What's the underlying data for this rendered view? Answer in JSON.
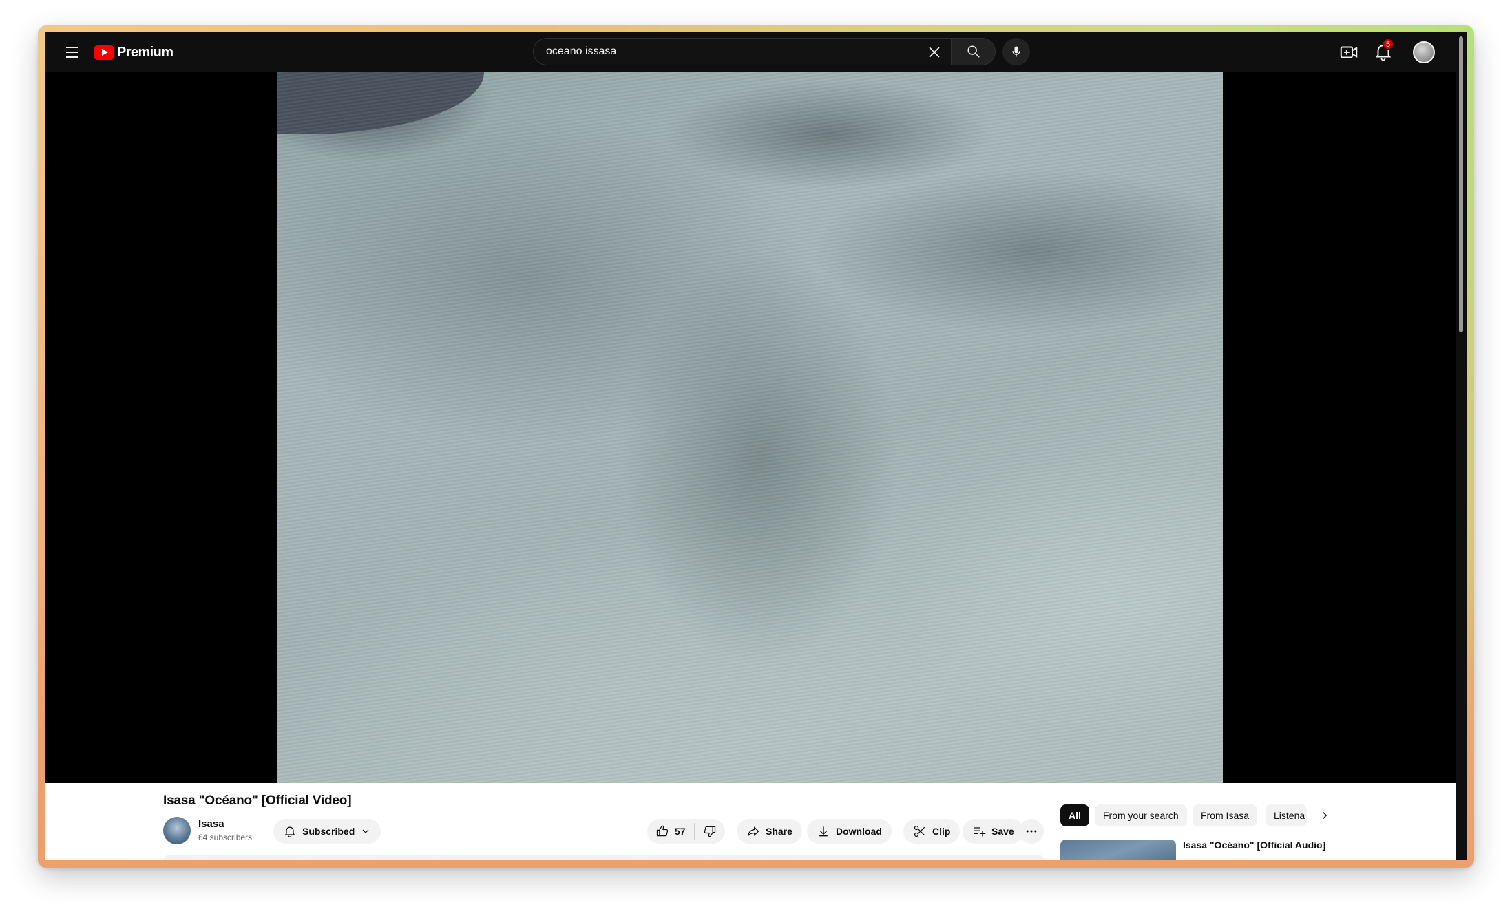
{
  "header": {
    "brand": "Premium",
    "search": {
      "value": "oceano issasa",
      "placeholder": "Search"
    },
    "notifications_count": "5"
  },
  "video": {
    "title": "Isasa \"Océano\" [Official Video]"
  },
  "channel": {
    "name": "Isasa",
    "subscribers": "64 subscribers",
    "subscribe_label": "Subscribed"
  },
  "actions": {
    "likes": "57",
    "share": "Share",
    "download": "Download",
    "clip": "Clip",
    "save": "Save"
  },
  "sidebar": {
    "chips": [
      "All",
      "From your search",
      "From Isasa",
      "Listena"
    ],
    "active_chip": "All",
    "recommendations": [
      {
        "title": "Isasa \"Océano\" [Official Audio]"
      }
    ]
  },
  "colors": {
    "brand_red": "#ff0000",
    "dark_bg": "#0f0f0f",
    "badge_red": "#cc0000"
  }
}
